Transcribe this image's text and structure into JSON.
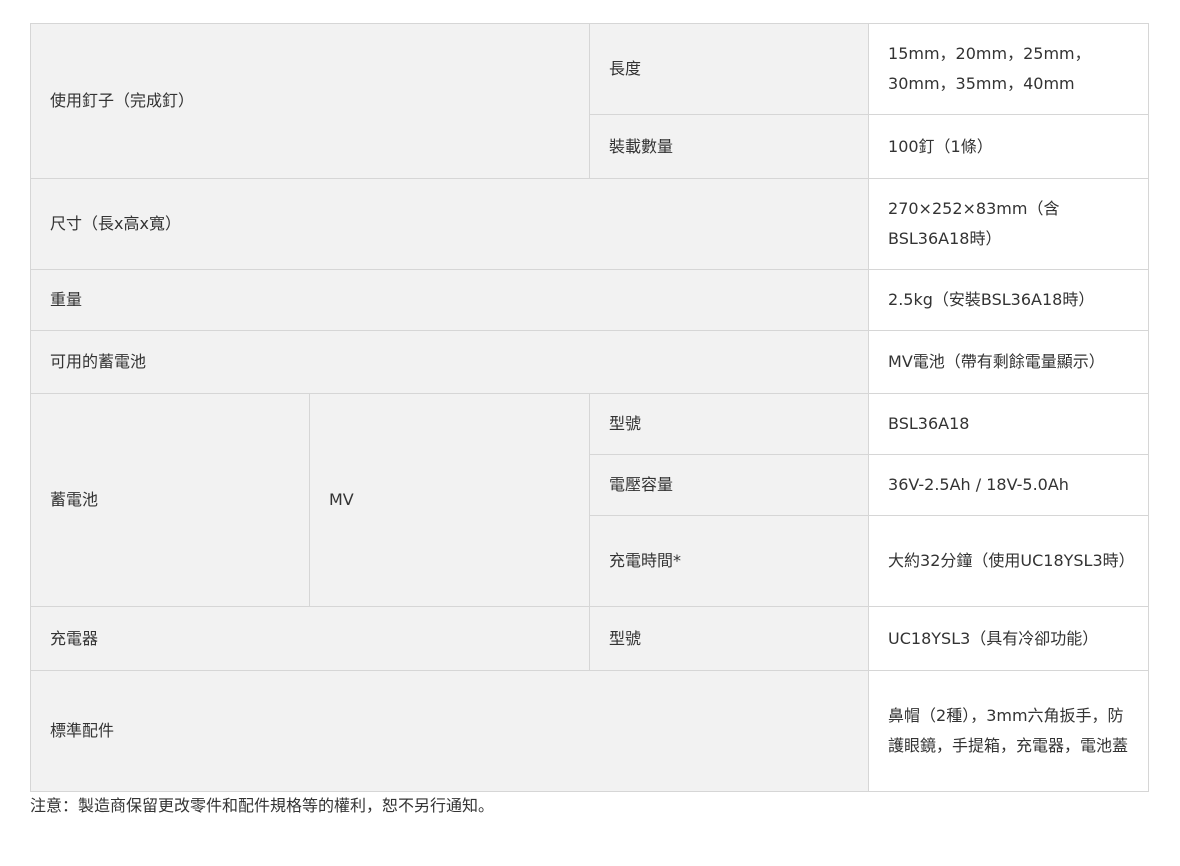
{
  "rows": {
    "nails": {
      "label": "使用釘子（完成釘）",
      "length_label": "長度",
      "length_value": "15mm，20mm，25mm，30mm，35mm，40mm",
      "capacity_label": "裝載數量",
      "capacity_value": "100釘（1條）"
    },
    "dimensions": {
      "label": "尺寸（長x高x寬）",
      "value": "270×252×83mm（含BSL36A18時）"
    },
    "weight": {
      "label": "重量",
      "value": "2.5kg（安裝BSL36A18時）"
    },
    "battery_compat": {
      "label": "可用的蓄電池",
      "value": "MV電池（帶有剩餘電量顯示）"
    },
    "battery": {
      "label": "蓄電池",
      "type": "MV",
      "model_label": "型號",
      "model_value": "BSL36A18",
      "voltage_label": "電壓容量",
      "voltage_value": "36V-2.5Ah / 18V-5.0Ah",
      "charge_label": "充電時間*",
      "charge_value": "大約32分鐘（使用UC18YSL3時）"
    },
    "charger": {
      "label": "充電器",
      "model_label": "型號",
      "model_value": "UC18YSL3（具有冷卻功能）"
    },
    "accessories": {
      "label": "標準配件",
      "value": "鼻帽（2種），3mm六角扳手，防護眼鏡，手提箱，充電器，電池蓋"
    }
  },
  "note": "注意：製造商保留更改零件和配件規格等的權利，恕不另行通知。"
}
